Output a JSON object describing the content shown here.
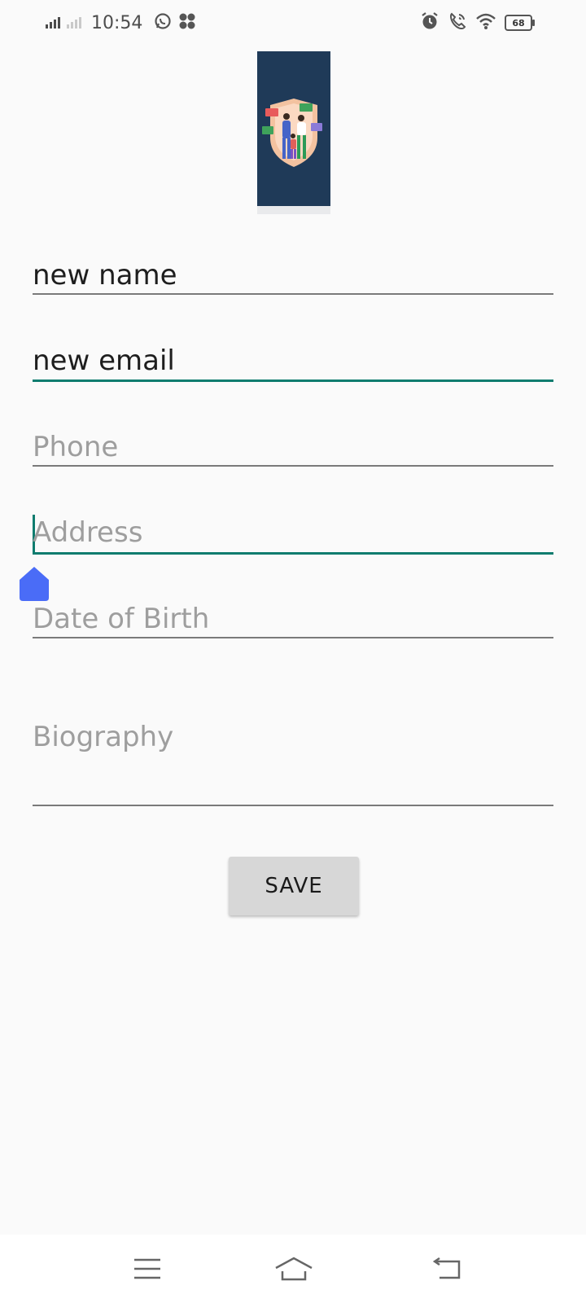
{
  "status_bar": {
    "time": "10:54",
    "battery": "68",
    "icons": [
      "signal-icon",
      "signal-dim-icon",
      "whatsapp-icon",
      "fan-icon",
      "alarm-icon",
      "wifi-calling-icon",
      "wifi-icon",
      "battery-icon"
    ]
  },
  "form": {
    "name_value": "new name",
    "email_value": "new email",
    "phone_placeholder": "Phone",
    "address_placeholder": "Address",
    "dob_placeholder": "Date of Birth",
    "biography_placeholder": "Biography",
    "save_label": "SAVE"
  },
  "colors": {
    "accent": "#0f7c6f",
    "selection_handle": "#4a6cf7",
    "button_bg": "#d7d7d7"
  },
  "nav_bar": {
    "icons": [
      "menu-icon",
      "home-icon",
      "back-icon"
    ]
  }
}
